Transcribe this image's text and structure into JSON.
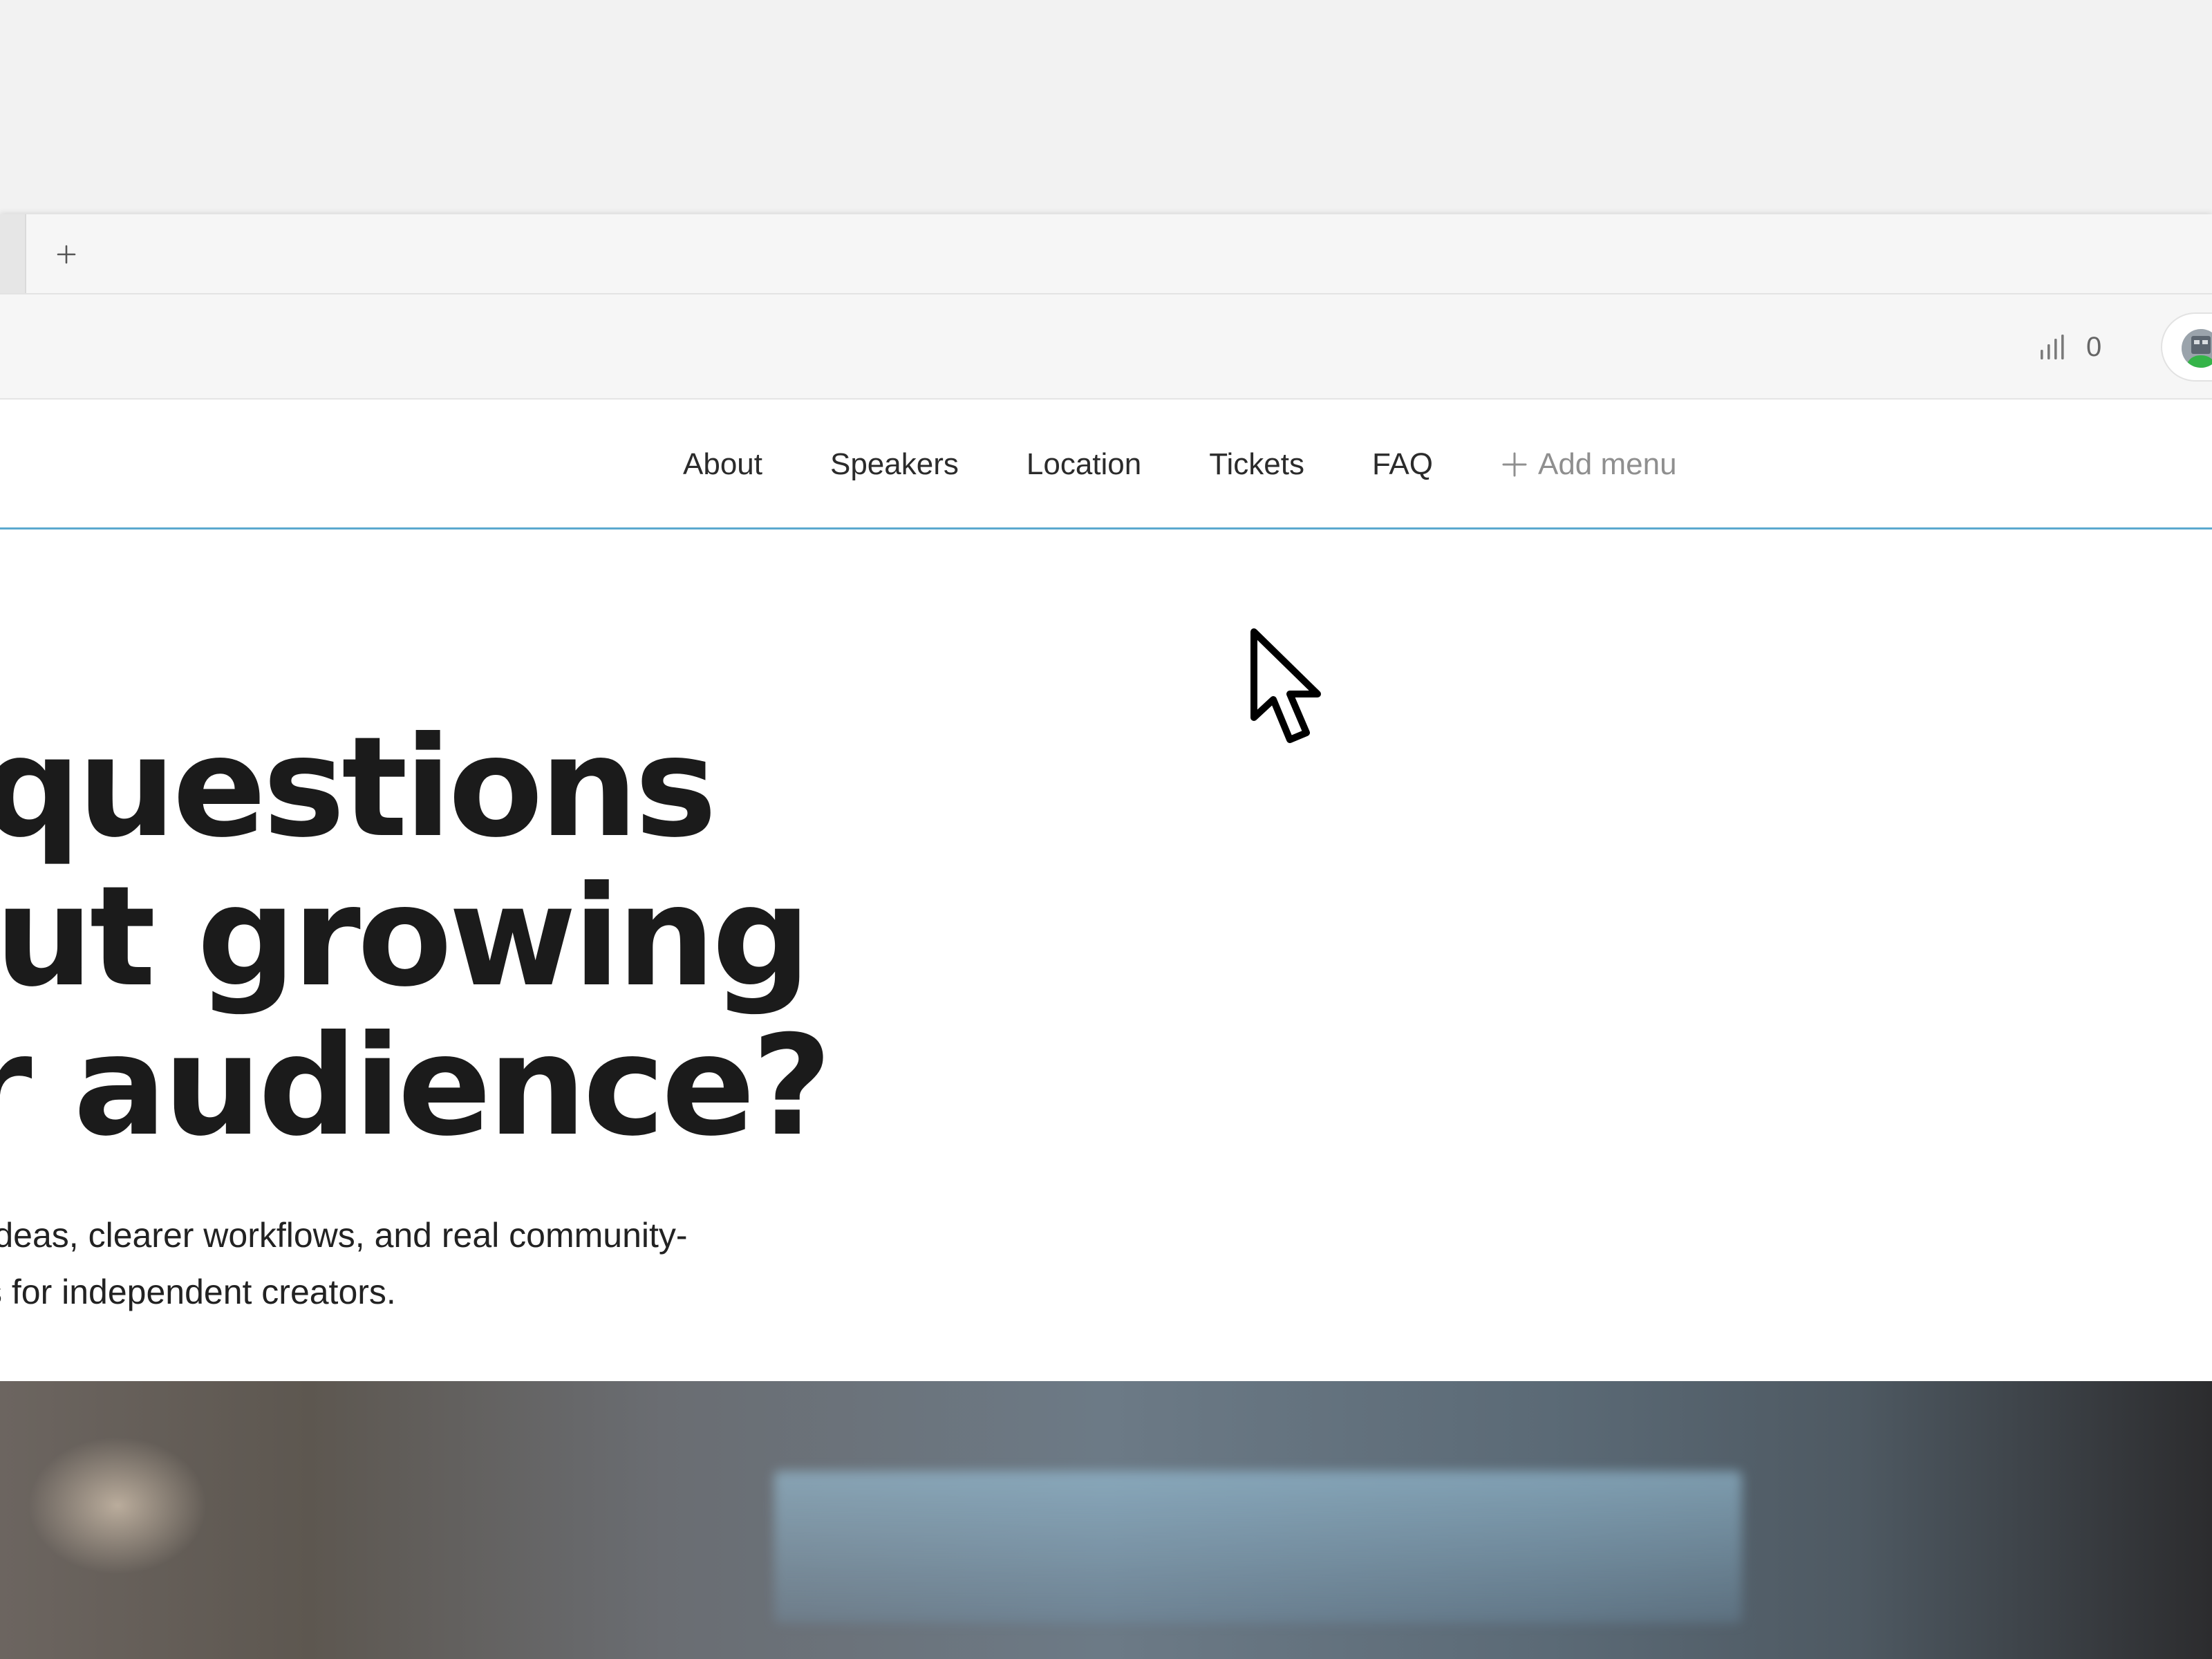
{
  "browser": {
    "tab_bar": {
      "new_tab_label": "+"
    },
    "toolbar": {
      "analytics_count": "0"
    }
  },
  "site_nav": {
    "items": [
      {
        "label": "About"
      },
      {
        "label": "Speakers"
      },
      {
        "label": "Location"
      },
      {
        "label": "Tickets"
      },
      {
        "label": "FAQ"
      }
    ],
    "add_menu_label": "Add menu"
  },
  "hero": {
    "title_lines": [
      "questions",
      "out growing",
      "r audience?"
    ],
    "subtitle_lines": [
      "ractical ideas, clearer workflows, and real community-",
      "s for independent creators."
    ]
  },
  "colors": {
    "nav_accent": "#5aa9cf",
    "heading_text": "#1b1b1b",
    "body_text": "#222222",
    "muted_text": "#8f8f8f"
  },
  "icons": {
    "new_tab": "plus-icon",
    "analytics": "bar-chart-icon",
    "add_menu": "plus-icon",
    "pointer": "cursor-arrow-icon"
  }
}
